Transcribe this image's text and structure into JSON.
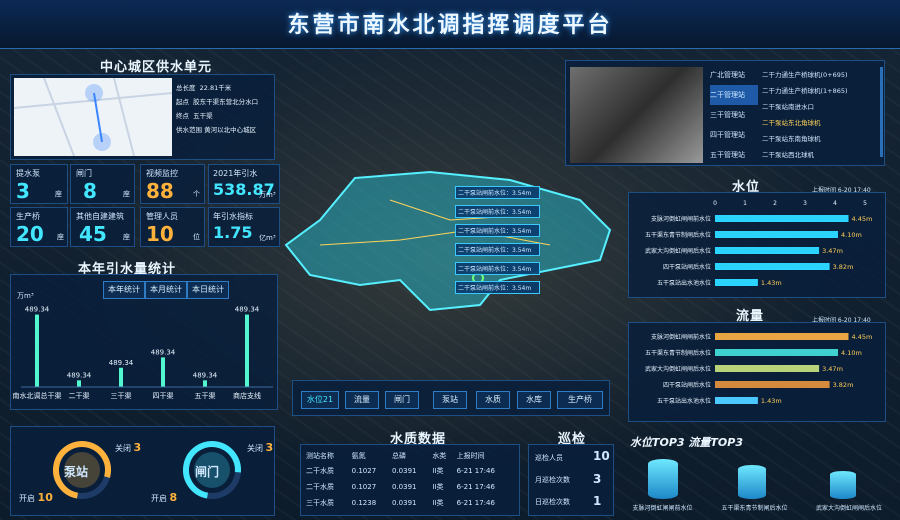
{
  "header": {
    "title": "东营市南水北调指挥调度平台"
  },
  "supply_unit": {
    "title": "中心城区供水单元",
    "info": [
      {
        "k": "总长度",
        "v": "22.81千米"
      },
      {
        "k": "起点",
        "v": "胶东干渠东营北分水口"
      },
      {
        "k": "终点",
        "v": "五干渠"
      },
      {
        "k": "供水范围",
        "v": "黄河以北中心城区"
      }
    ]
  },
  "stats": [
    {
      "label": "提水泵",
      "value": "3",
      "unit": "座"
    },
    {
      "label": "闸门",
      "value": "8",
      "unit": "座"
    },
    {
      "label": "视频监控",
      "value": "88",
      "unit": "个"
    },
    {
      "label": "2021年引水",
      "value": "538.87",
      "unit": "万m³"
    },
    {
      "label": "生产桥",
      "value": "20",
      "unit": "座"
    },
    {
      "label": "其他自建建筑",
      "value": "45",
      "unit": "座"
    },
    {
      "label": "管理人员",
      "value": "10",
      "unit": "位"
    },
    {
      "label": "年引水指标",
      "value": "1.75",
      "unit": "亿m³"
    }
  ],
  "intake": {
    "title": "本年引水量统计",
    "tabs": [
      "本年统计",
      "本月统计",
      "本日统计"
    ],
    "chart_data": {
      "type": "bar",
      "ylabel": "万m³",
      "categories": [
        "南水北调总干渠",
        "二干渠",
        "三干渠",
        "四干渠",
        "五干渠",
        "商店支线"
      ],
      "values": [
        489.34,
        489.34,
        489.34,
        489.34,
        489.34,
        489.34
      ],
      "heights_note": "",
      "display_values": [
        489.34,
        45,
        130,
        200,
        45,
        489.34
      ]
    }
  },
  "pump": {
    "center": "泵站",
    "closed_label": "关闭",
    "closed": "3",
    "open_label": "开启",
    "open": "10"
  },
  "gate": {
    "center": "闸门",
    "closed_label": "关闭",
    "closed": "3",
    "open_label": "开启",
    "open": "8"
  },
  "map": {
    "labels": [
      {
        "name": "二干泵站闸前水位：3.54m"
      },
      {
        "name": "二干泵站闸前水位：3.54m"
      },
      {
        "name": "二干泵站闸前水位：3.54m"
      },
      {
        "name": "二干泵站闸前水位：3.54m"
      },
      {
        "name": "二干泵站闸前水位：3.54m"
      },
      {
        "name": "二干泵站闸前水位：3.54m"
      }
    ],
    "bottom_tabs": [
      "水位21",
      "流量",
      "闸门",
      "泵站",
      "水质",
      "水库",
      "生产桥"
    ]
  },
  "video": {
    "stations": [
      "广北管理站",
      "二干管理站",
      "三干管理站",
      "四干管理站",
      "五干管理站"
    ],
    "active_station": "二干管理站",
    "cameras": [
      "二干力通生产桥球机(0+695)",
      "二干力通生产桥球机(1+865)",
      "二干泵站南进水口",
      "二干泵站东北角球机",
      "二干泵站东南角球机",
      "二干泵站西北球机"
    ],
    "active_camera": "二干泵站东北角球机"
  },
  "water_level": {
    "title": "水位",
    "updated": "上报时间 6-20 17:40",
    "chart_data": {
      "type": "bar",
      "orientation": "horizontal",
      "categories": [
        "支脉河倒虹闸闸前水位",
        "五干渠东青节制闸后水位",
        "武家大沟倒虹闸闸后水位",
        "四干泵站闸后水位",
        "五干泵站出水池水位"
      ],
      "values": [
        4.45,
        4.1,
        3.47,
        3.82,
        1.43
      ],
      "unit": "m",
      "xlim": [
        0,
        5
      ],
      "ticks": [
        0,
        1,
        2,
        3,
        4,
        5
      ]
    }
  },
  "flow": {
    "title": "流量",
    "updated": "上报时间 6-20 17:40",
    "chart_data": {
      "type": "bar",
      "orientation": "horizontal",
      "categories": [
        "支脉河倒虹闸闸前水位",
        "五干渠东青节制闸后水位",
        "武家大沟倒虹闸闸后水位",
        "四干泵站闸后水位",
        "五干泵站出水池水位"
      ],
      "values": [
        4.45,
        4.1,
        3.47,
        3.82,
        1.43
      ],
      "unit": "m",
      "xlim": [
        0,
        5
      ]
    }
  },
  "quality": {
    "title": "水质数据",
    "headers": [
      "测站名称",
      "氨氮",
      "总磷",
      "水类",
      "上报时间"
    ],
    "rows": [
      [
        "二干水质",
        "0.1027",
        "0.0391",
        "II类",
        "6-21 17:46"
      ],
      [
        "二干水质",
        "0.1027",
        "0.0391",
        "II类",
        "6-21 17:46"
      ],
      [
        "三干水质",
        "0.1238",
        "0.0391",
        "II类",
        "6-21 17:46"
      ]
    ]
  },
  "patrol": {
    "title": "巡检",
    "items": [
      {
        "k": "巡检人员",
        "v": "10"
      },
      {
        "k": "月巡检次数",
        "v": "3"
      },
      {
        "k": "日巡检次数",
        "v": "1"
      }
    ]
  },
  "top3": {
    "title": "水位TOP3  流量TOP3",
    "items": [
      "支脉河倒虹闸闸前水位",
      "五干渠东青节制闸后水位",
      "武家大沟倒虹闸闸后水位"
    ]
  },
  "colors": {
    "accent": "#42e7ff",
    "orange": "#ffb23b",
    "bar": "#2ad4ff",
    "bg": "#061327"
  }
}
